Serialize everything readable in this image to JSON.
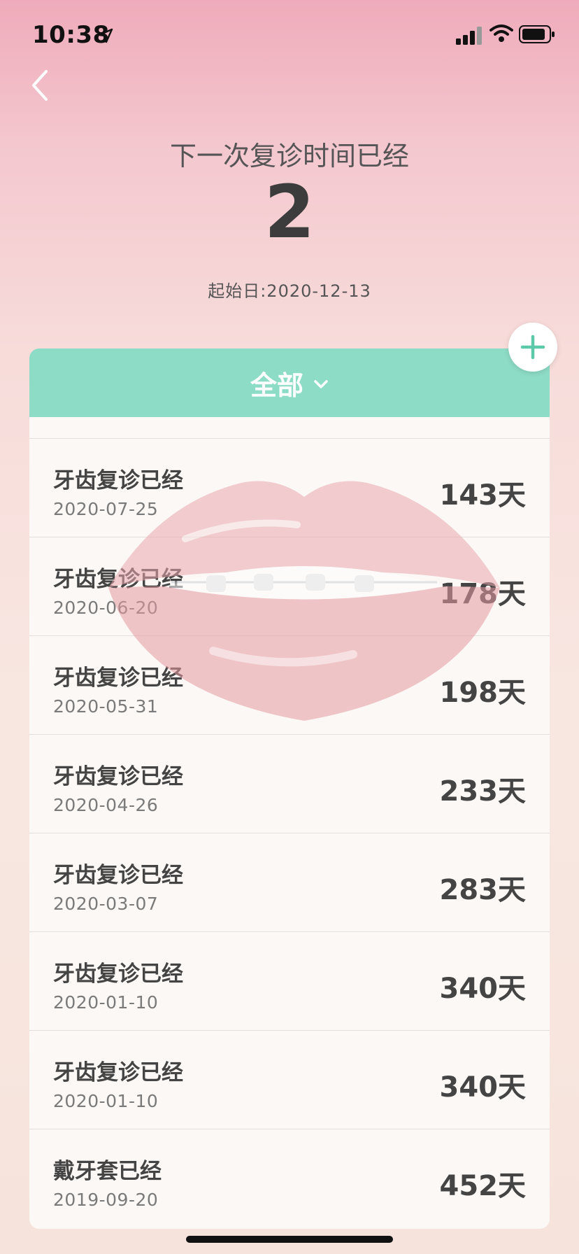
{
  "status": {
    "time": "10:38"
  },
  "header": {
    "headline": "下一次复诊时间已经",
    "big_number": "2",
    "start_date": "起始日:2020-12-13"
  },
  "filter": {
    "label": "全部"
  },
  "records": [
    {
      "title": "牙齿复诊已经",
      "date": "2020-07-25",
      "days": "143天"
    },
    {
      "title": "牙齿复诊已经",
      "date": "2020-06-20",
      "days": "178天"
    },
    {
      "title": "牙齿复诊已经",
      "date": "2020-05-31",
      "days": "198天"
    },
    {
      "title": "牙齿复诊已经",
      "date": "2020-04-26",
      "days": "233天"
    },
    {
      "title": "牙齿复诊已经",
      "date": "2020-03-07",
      "days": "283天"
    },
    {
      "title": "牙齿复诊已经",
      "date": "2020-01-10",
      "days": "340天"
    },
    {
      "title": "牙齿复诊已经",
      "date": "2020-01-10",
      "days": "340天"
    },
    {
      "title": "戴牙套已经",
      "date": "2019-09-20",
      "days": "452天"
    }
  ],
  "colors": {
    "accent": "#8ddcc6",
    "plus": "#5cc9a8"
  },
  "icons": {
    "back": "chevron-left-icon",
    "add": "plus-icon",
    "filter": "chevron-down-icon"
  }
}
